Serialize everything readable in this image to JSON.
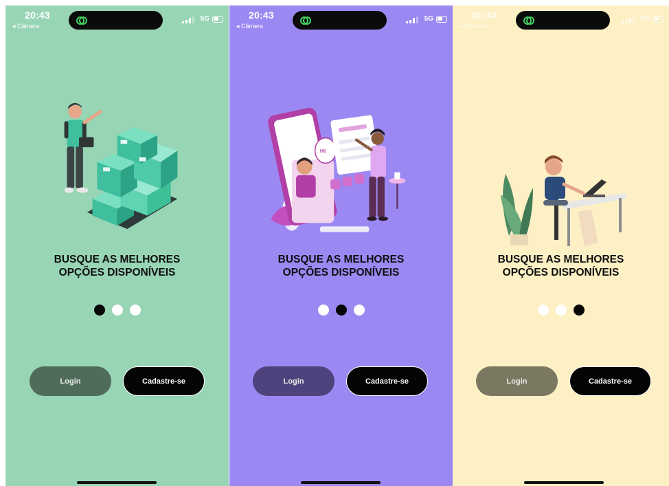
{
  "screens": [
    {
      "status": {
        "time": "20:43",
        "back_label": "◂ Câmera",
        "network": "5G"
      },
      "title_line1": "BUSQUE AS MELHORES",
      "title_line2": "OPÇÕES DISPONÍVEIS",
      "active_page": 1,
      "page_count": 3,
      "login_label": "Login",
      "signup_label": "Cadastre-se",
      "colors": {
        "background": "#98d5b5",
        "login_button": "#4f6b5a"
      }
    },
    {
      "status": {
        "time": "20:43",
        "back_label": "◂ Câmera",
        "network": "5G"
      },
      "title_line1": "BUSQUE AS MELHORES",
      "title_line2": "OPÇÕES DISPONÍVEIS",
      "active_page": 2,
      "page_count": 3,
      "login_label": "Login",
      "signup_label": "Cadastre-se",
      "colors": {
        "background": "#9c88f2",
        "login_button": "#4f437e"
      }
    },
    {
      "status": {
        "time": "20:44",
        "back_label": "◂ Câmera",
        "network": "5G"
      },
      "title_line1": "BUSQUE AS MELHORES",
      "title_line2": "OPÇÕES DISPONÍVEIS",
      "active_page": 3,
      "page_count": 3,
      "login_label": "Login",
      "signup_label": "Cadastre-se",
      "colors": {
        "background": "#fdf0c5",
        "login_button": "#7b7862"
      }
    }
  ],
  "icons": [
    "app-link-icon",
    "signal-icon",
    "battery-icon",
    "delivery-boxes-illustration",
    "video-call-illustration",
    "laptop-work-illustration"
  ]
}
